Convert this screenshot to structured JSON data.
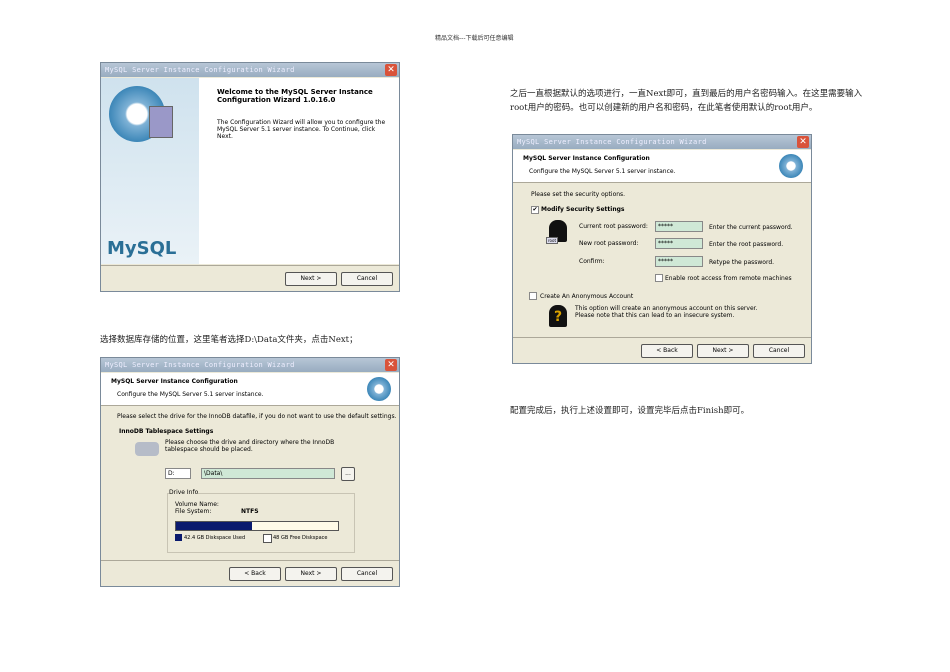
{
  "header": "精品文档---下载后可任意编辑",
  "paragraphs": {
    "p1": "之后一直根据默认的选项进行，一直Next即可，直到最后的用户名密码输入。在这里需要输入root用户的密码。也可以创建新的用户名和密码，在此笔者使用默认的root用户。",
    "p2": "选择数据库存储的位置，这里笔者选择D:\\Data文件夹，点击Next；",
    "p3": "配置完成后，执行上述设置即可，设置完毕后点击Finish即可。"
  },
  "window_title": "MySQL Server Instance Configuration Wizard",
  "close": "✕",
  "dialog1": {
    "heading": "Welcome to the MySQL Server Instance Configuration Wizard 1.0.16.0",
    "body": "The Configuration Wizard will allow you to configure the MySQL Server 5.1 server instance. To Continue, click Next.",
    "logo": "MySQL",
    "next": "Next >",
    "cancel": "Cancel"
  },
  "dialog2": {
    "title": "MySQL Server Instance Configuration",
    "subtitle": "Configure the MySQL Server 5.1 server instance.",
    "intro": "Please select the drive for the InnoDB datafile, if you do not want to use the default settings.",
    "section": "InnoDB Tablespace Settings",
    "desc": "Please choose the drive and directory where the InnoDB tablespace should be placed.",
    "drive": "D:",
    "path": "\\Data\\",
    "browse": "...",
    "drive_info": "Drive Info",
    "volume_label": "Volume Name:",
    "fs_label": "File System:",
    "fs_value": "NTFS",
    "used": "42.4 GB Diskspace Used",
    "free": "48 GB Free Diskspace",
    "used_fraction": 0.47,
    "back": "< Back",
    "next": "Next >",
    "cancel": "Cancel"
  },
  "dialog3": {
    "title": "MySQL Server Instance Configuration",
    "subtitle": "Configure the MySQL Server 5.1 server instance.",
    "intro": "Please set the security options.",
    "modify": "Modify Security Settings",
    "check": "✔",
    "current_label": "Current root password:",
    "new_label": "New root password:",
    "confirm_label": "Confirm:",
    "masked": "*****",
    "current_hint": "Enter the current password.",
    "new_hint": "Enter the root password.",
    "confirm_hint": "Retype the password.",
    "remote": "Enable root access from remote machines",
    "root_tag": "root",
    "anon": "Create An Anonymous Account",
    "anon_desc": "This option will create an anonymous account on this server. Please note that this can lead to an insecure system.",
    "q": "?",
    "back": "< Back",
    "next": "Next >",
    "cancel": "Cancel"
  }
}
